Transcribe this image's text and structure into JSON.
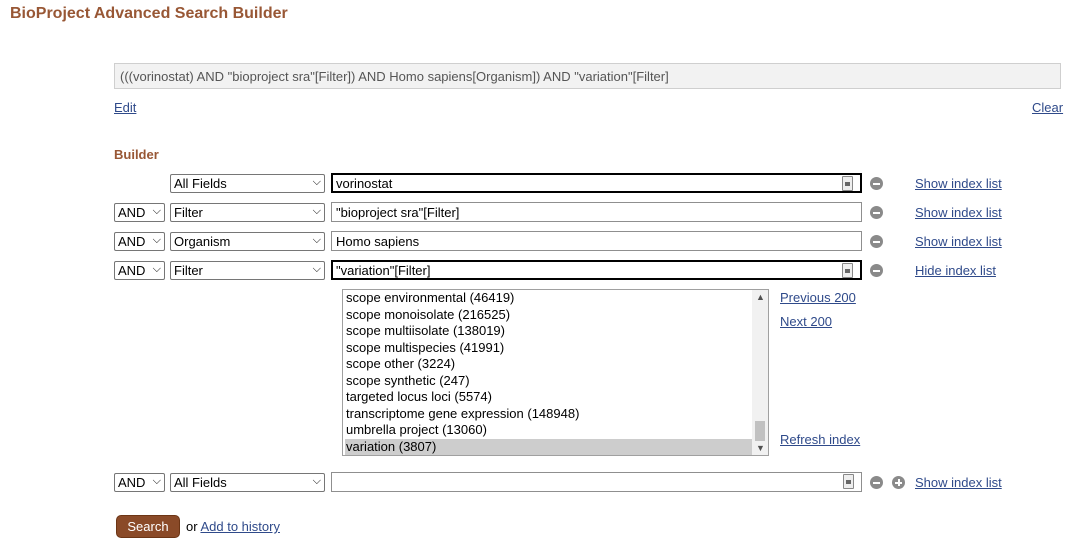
{
  "page": {
    "title": "BioProject Advanced Search Builder",
    "query": "(((vorinostat) AND \"bioproject sra\"[Filter]) AND Homo sapiens[Organism]) AND \"variation\"[Filter]",
    "edit_link": "Edit",
    "clear_link": "Clear"
  },
  "builder": {
    "heading": "Builder",
    "rows": [
      {
        "bool": "",
        "field": "All Fields",
        "term": "vorinostat",
        "index_link": "Show index list"
      },
      {
        "bool": "AND",
        "field": "Filter",
        "term": "\"bioproject sra\"[Filter]",
        "index_link": "Show index list"
      },
      {
        "bool": "AND",
        "field": "Organism",
        "term": "Homo sapiens",
        "index_link": "Show index list"
      },
      {
        "bool": "AND",
        "field": "Filter",
        "term": "\"variation\"[Filter]",
        "index_link": "Hide index list"
      },
      {
        "bool": "AND",
        "field": "All Fields",
        "term": "",
        "index_link": "Show index list"
      }
    ],
    "index_list": {
      "items": [
        "scope environmental (46419)",
        "scope monoisolate (216525)",
        "scope multiisolate (138019)",
        "scope multispecies (41991)",
        "scope other (3224)",
        "scope synthetic (247)",
        "targeted locus loci (5574)",
        "transcriptome gene expression (148948)",
        "umbrella project (13060)",
        "variation (3807)"
      ],
      "selected": "variation (3807)",
      "previous_link": "Previous 200",
      "next_link": "Next 200",
      "refresh_link": "Refresh index"
    }
  },
  "actions": {
    "search_button": "Search",
    "or_text": "or",
    "add_history_link": "Add to history"
  },
  "colors": {
    "accent": "#985735",
    "link": "#2f4a8a",
    "button": "#8a4a28"
  }
}
